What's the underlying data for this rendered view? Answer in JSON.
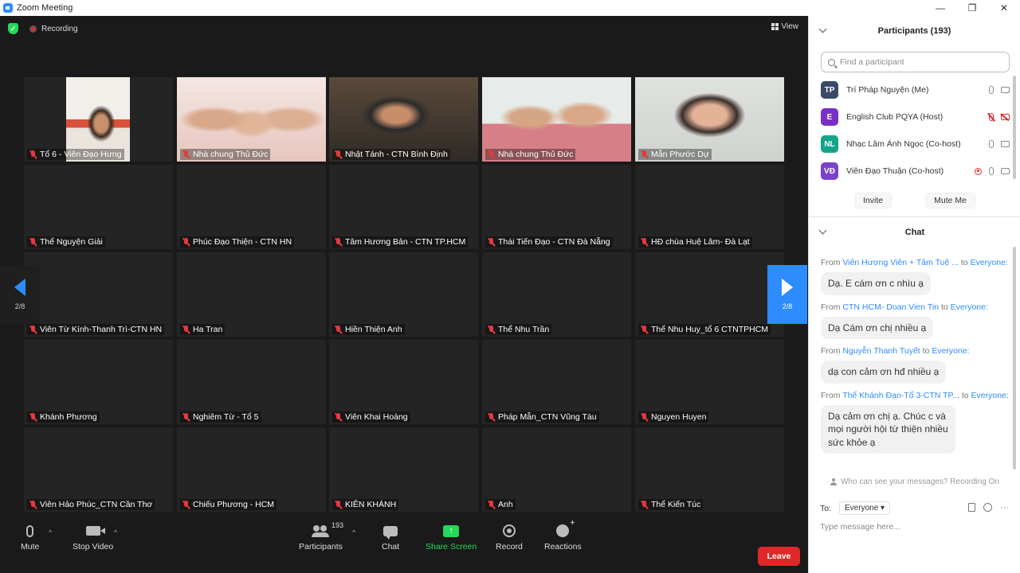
{
  "window": {
    "title": "Zoom Meeting",
    "minimize": "—",
    "maximize": "❐",
    "close": "✕"
  },
  "meeting": {
    "recording_label": "Recording",
    "view_label": "View",
    "page_indicator": "2/8",
    "tiles": [
      {
        "name": "Tổ 6  - Viên Đạo Hưng",
        "video": "single"
      },
      {
        "name": "Nhà chung Thủ Đức",
        "video": "girls"
      },
      {
        "name": "Nhật Tánh - CTN Bình Định",
        "video": "room"
      },
      {
        "name": "Nhà chung Thủ Đức",
        "video": "pair"
      },
      {
        "name": "Mẫn Phước Dự",
        "video": "woman"
      },
      {
        "name": "Thể Nguyện Giải"
      },
      {
        "name": "Phúc Đạo Thiện - CTN HN"
      },
      {
        "name": "Tâm Hương Bản - CTN TP.HCM"
      },
      {
        "name": "Thái Tiến Đạo - CTN Đà Nẵng"
      },
      {
        "name": "HĐ chùa Huệ Lâm- Đà Lạt"
      },
      {
        "name": "Viên Từ Kính-Thanh Trì-CTN HN"
      },
      {
        "name": "Ha Tran"
      },
      {
        "name": "Hiền Thiện Anh"
      },
      {
        "name": "Thể Nhu Trần"
      },
      {
        "name": "Thể Nhu Huy_tổ 6 CTNTPHCM"
      },
      {
        "name": "Khánh Phương"
      },
      {
        "name": "Nghiêm Từ - Tổ 5"
      },
      {
        "name": "Viên Khai Hoàng"
      },
      {
        "name": "Pháp Mẫn_CTN Vũng Tàu"
      },
      {
        "name": "Nguyen Huyen"
      },
      {
        "name": "Viên Hảo Phúc_CTN Cần Thơ"
      },
      {
        "name": "Chiếu Phương - HCM"
      },
      {
        "name": "KIÊN KHÁNH"
      },
      {
        "name": "Anh"
      },
      {
        "name": "Thể Kiến Túc"
      }
    ]
  },
  "toolbar": {
    "mute": "Mute",
    "stop_video": "Stop Video",
    "participants": "Participants",
    "participants_count": "193",
    "chat": "Chat",
    "share_screen": "Share Screen",
    "record": "Record",
    "reactions": "Reactions",
    "leave": "Leave"
  },
  "participants_panel": {
    "title": "Participants (193)",
    "search_placeholder": "Find a participant",
    "list": [
      {
        "initials": "TP",
        "color": "#3a4a66",
        "name": "Trí Pháp Nguyện (Me)",
        "mic_off": false,
        "cam_off": false
      },
      {
        "initials": "E",
        "color": "#7a2fc4",
        "name": "English Club PQYA (Host)",
        "mic_off": true,
        "cam_off": true
      },
      {
        "initials": "NL",
        "color": "#13a58a",
        "name": "Nhạc Lâm Ánh Ngọc (Co-host)",
        "mic_off": false,
        "cam_off": false
      },
      {
        "initials": "VĐ",
        "color": "#7a42c8",
        "name": "Viên Đạo Thuận (Co-host)",
        "mic_off": false,
        "cam_off": false,
        "recording": true
      }
    ],
    "invite": "Invite",
    "mute_me": "Mute Me"
  },
  "chat_panel": {
    "title": "Chat",
    "messages": [
      {
        "from_label": "From",
        "sender": "Viên Hương Viên + Tâm Tuệ ...",
        "to_label": "to",
        "recipient": "Everyone:",
        "text": [
          "Dạ. E cám ơn c nhìu ạ"
        ]
      },
      {
        "from_label": "From",
        "sender": "CTN HCM- Doan Vien Tin",
        "to_label": "to",
        "recipient": "Everyone:",
        "text": [
          "Dạ Cám ơn chị nhiều ạ"
        ]
      },
      {
        "from_label": "From",
        "sender": "Nguyễn Thanh Tuyết",
        "to_label": "to",
        "recipient": "Everyone:",
        "text": [
          "dạ con cảm ơn hđ nhiều ạ"
        ]
      },
      {
        "from_label": "From",
        "sender": "Thể Khánh Đạo-Tổ 3-CTN TP...",
        "to_label": "to",
        "recipient": "Everyone:",
        "text": [
          "Dạ cảm ơn chị ạ. Chúc c và",
          "mọi người hội từ thiện nhiều",
          "sức khỏe ạ"
        ]
      }
    ],
    "visibility_note": "Who can see your messages? Recording On",
    "to_label": "To:",
    "to_value": "Everyone",
    "input_placeholder": "Type message here..."
  }
}
